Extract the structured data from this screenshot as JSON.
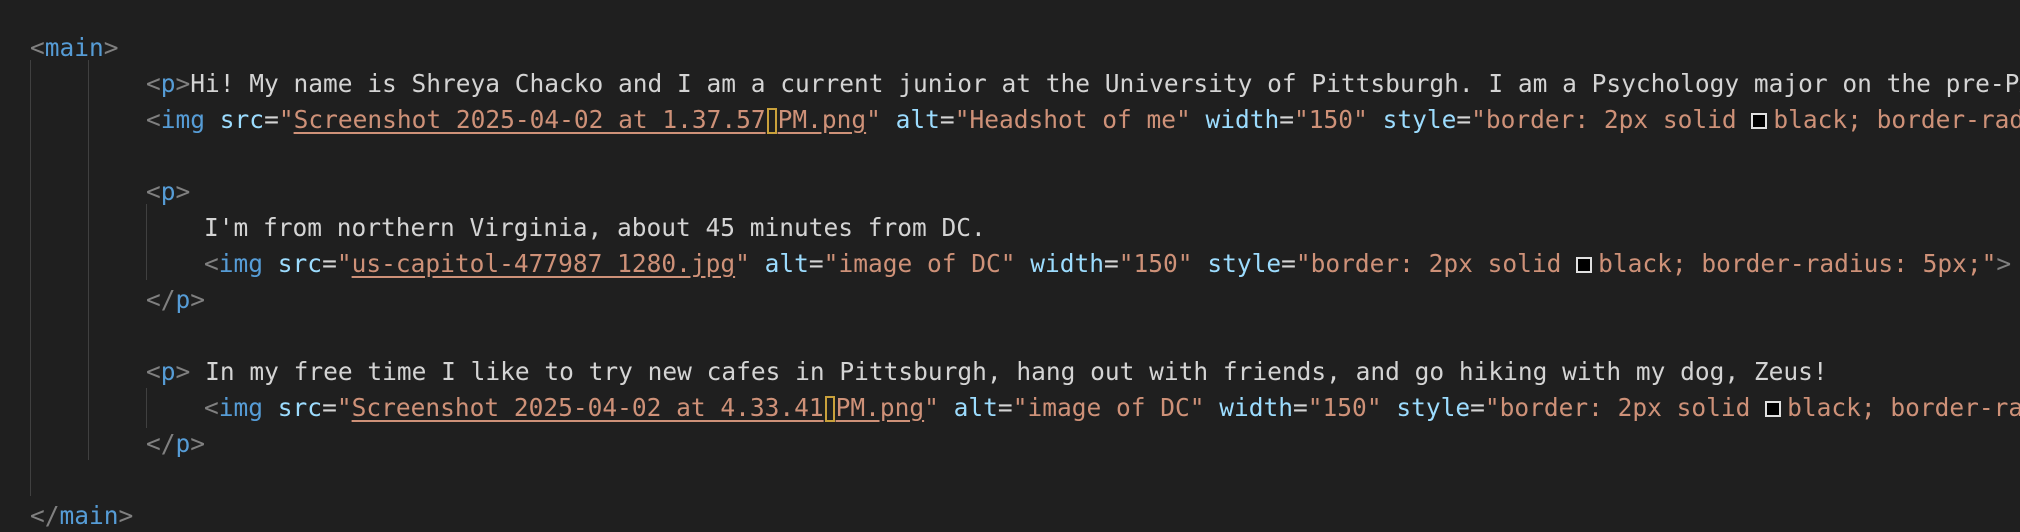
{
  "code": {
    "main_open": "main",
    "main_close": "main",
    "p_tag": "p",
    "img_tag": "img",
    "attr_src": "src",
    "attr_alt": "alt",
    "attr_width": "width",
    "attr_style": "style",
    "para1_text": "Hi! My name is Shreya Chacko and I am a current junior at the University of Pittsburgh. I am a Psychology major on the pre-PA t",
    "img1_src_a": "Screenshot 2025-04-02 at 1.37.57",
    "img1_src_b": "PM.png",
    "img1_alt": "Headshot of me",
    "img1_width": "150",
    "img1_style_a": "border: 2px solid ",
    "img1_style_b": "black; border-radiu",
    "para2_text": "I'm from northern Virginia, about 45 minutes from DC.",
    "img2_src": "us-capitol-477987_1280.jpg",
    "img2_alt": "image of DC",
    "img2_width": "150",
    "img2_style_a": "border: 2px solid ",
    "img2_style_b": "black; border-radius: 5px;",
    "para3_text": "In my free time I like to try new cafes in Pittsburgh, hang out with friends, and go hiking with my dog, Zeus!",
    "img3_src_a": "Screenshot 2025-04-02 at 4.33.41",
    "img3_src_b": "PM.png",
    "img3_alt": "image of DC",
    "img3_width": "150",
    "img3_style_a": "border: 2px solid ",
    "img3_style_b": "black; border-radi"
  },
  "colors": {
    "background": "#1f1f1f",
    "tag": "#569cd6",
    "attribute": "#9cdcfe",
    "string": "#ce9178",
    "punctuation": "#808080",
    "text": "#d4d4d4"
  }
}
